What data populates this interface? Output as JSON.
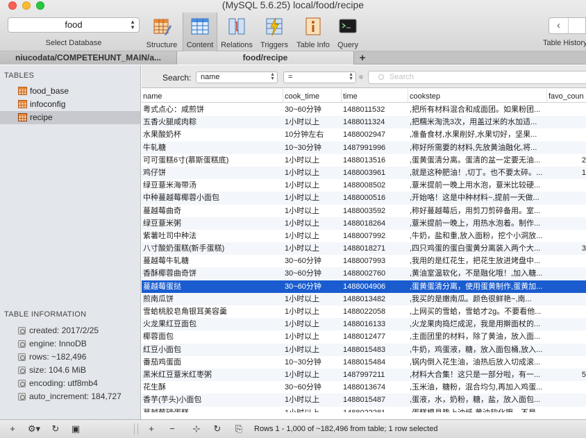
{
  "window": {
    "title": "(MySQL 5.6.25) local/food/recipe"
  },
  "toolbar": {
    "database": {
      "value": "food",
      "label": "Select Database"
    },
    "buttons": [
      {
        "label": "Structure",
        "icon": "structure-icon"
      },
      {
        "label": "Content",
        "icon": "content-icon"
      },
      {
        "label": "Relations",
        "icon": "relations-icon"
      },
      {
        "label": "Triggers",
        "icon": "triggers-icon"
      },
      {
        "label": "Table Info",
        "icon": "table-info-icon"
      },
      {
        "label": "Query",
        "icon": "query-icon"
      }
    ],
    "history_label": "Table History",
    "back_glyph": "‹"
  },
  "tabs": [
    {
      "label": "niucodata/COMPETEHUNT_MAIN/a..."
    },
    {
      "label": "food/recipe"
    }
  ],
  "tab_add": "+",
  "sidebar": {
    "tables_header": "TABLES",
    "tables": [
      "food_base",
      "infoconfig",
      "recipe"
    ],
    "info_header": "TABLE INFORMATION",
    "info": [
      "created: 2017/2/25",
      "engine: InnoDB",
      "rows: ~182,496",
      "size: 104.6 MiB",
      "encoding: utf8mb4",
      "auto_increment: 184,727"
    ]
  },
  "search": {
    "label": "Search:",
    "field": "name",
    "operator": "=",
    "placeholder": "Search"
  },
  "table": {
    "columns": [
      "name",
      "cook_time",
      "time",
      "cookstep",
      "favo_coun"
    ],
    "rows": [
      [
        "粤式点心：咸煎饼",
        "30~60分钟",
        "1488011532",
        ",把所有材料混合和成面团。如果粉团...",
        ""
      ],
      [
        "五香火腿咸肉粽",
        "1小时以上",
        "1488011324",
        ",把糯米淘洗3次，用盖过米的水加适...",
        ""
      ],
      [
        "水果酸奶杯",
        "10分钟左右",
        "1488002947",
        ",准备食材,水果削好,水果切好，坚果...",
        ""
      ],
      [
        "牛轧糖",
        "10~30分钟",
        "1487991996",
        ",称好所需要的材料,先放黄油融化,将...",
        ""
      ],
      [
        "可可蛋糕6寸(慕斯蛋糕底)",
        "1小时以上",
        "1488013516",
        ",蛋黄蛋清分离。蛋清的盆一定要无油...",
        "2"
      ],
      [
        "鸡仔饼",
        "1小时以上",
        "1488003961",
        ",就是这种肥油！,切丁。也不要太碎。...",
        "1"
      ],
      [
        "绿豆薏米海带汤",
        "1小时以上",
        "1488008502",
        ",薏米提前一晚上用水泡，薏米比较硬...",
        ""
      ],
      [
        "中种蔓越莓椰蓉小面包",
        "1小时以上",
        "1488000516",
        ",开始咯！这是中种材料~,提前一天做...",
        ""
      ],
      [
        "蔓越莓曲奇",
        "1小时以上",
        "1488003592",
        ",称好蔓越莓后，用剪刀剪碎备用。室...",
        ""
      ],
      [
        "绿豆薏米粥",
        "1小时以上",
        "1488018264",
        ",薏米提前一晚上，用热水泡着。制作...",
        ""
      ],
      [
        "紫薯吐司中种法",
        "1小时以上",
        "1488007992",
        ",牛奶，盐和重,放入面粉，挖个小洞放...",
        ""
      ],
      [
        "八寸酸奶蛋糕(新手蛋糕)",
        "1小时以上",
        "1488018271",
        ",四只鸡蛋的蛋白蛋黄分离装入两个大...",
        "3"
      ],
      [
        "蔓越莓牛轧糖",
        "30~60分钟",
        "1488007993",
        ",我用的是红花生，把花生放进烤盘中...",
        ""
      ],
      [
        "香酥椰蓉曲奇饼",
        "30~60分钟",
        "1488002760",
        ",黄油室温软化，不是融化哦！,加入糖...",
        ""
      ],
      [
        "蔓越莓蛋挞",
        "30~60分钟",
        "1488004906",
        ",蛋黄蛋清分离，使用蛋黄制作,蛋黄加...",
        ""
      ],
      [
        "煎南瓜饼",
        "1小时以上",
        "1488013482",
        ",我买的是嫩南瓜。颜色很鲜艳~,南...",
        ""
      ],
      [
        "雪蛤桃胶皂角银耳美容羹",
        "1小时以上",
        "1488022058",
        ",上网买的雪蛤，雪蛤才2g。不要看他...",
        ""
      ],
      [
        "火龙果红豆面包",
        "1小时以上",
        "1488016133",
        ",火龙果肉捣烂成泥，我是用擀面杖的...",
        ""
      ],
      [
        "椰蓉面包",
        "1小时以上",
        "1488012477",
        ",主面团里的材料，除了黄油，放入面...",
        ""
      ],
      [
        "红豆小面包",
        "1小时以上",
        "1488015483",
        ",牛奶，鸡蛋液，糖，放入面包桶,放入...",
        ""
      ],
      [
        "番茄鸡蛋面",
        "10~30分钟",
        "1488015484",
        ",锅内倒入花生油，油热后放入切成滚...",
        ""
      ],
      [
        "黑米红豆薏米红枣粥",
        "1小时以上",
        "1487997211",
        ",材料大合集！这只是一部分啦，有一...",
        "5"
      ],
      [
        "花生酥",
        "30~60分钟",
        "1488013674",
        ",玉米油，糖粉，混合均匀,再加入鸡蛋...",
        ""
      ],
      [
        "香芋(芋头)小面包",
        "1小时以上",
        "1488015487",
        ",蛋液，水，奶粉，糖，盐，放入面包...",
        ""
      ],
      [
        "蔓越莓磅蛋糕",
        "1小时以上",
        "1488022281",
        ",蛋糕模具垫上油纸,黄油软化哦，不是...",
        ""
      ]
    ],
    "selected_row": 14
  },
  "status": {
    "text": "Rows 1 - 1,000 of ~182,496 from table; 1 row selected"
  },
  "colors": {
    "selection": "#1a5ccf",
    "sidebar": "#e3e6ea",
    "table_icon": "#e88a3a"
  }
}
